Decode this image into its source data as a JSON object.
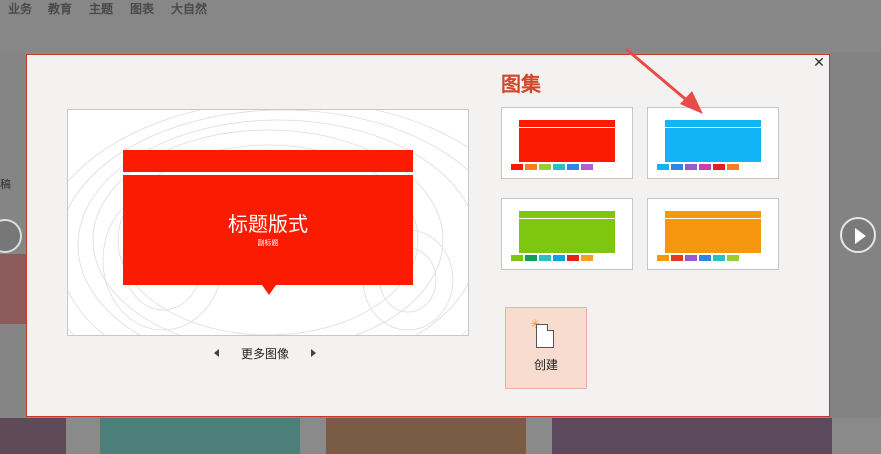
{
  "background": {
    "tabs": [
      "业务",
      "教育",
      "主题",
      "图表",
      "大自然"
    ],
    "left_partial_text": "稿"
  },
  "dialog": {
    "close_symbol": "✕",
    "preview": {
      "title": "标题版式",
      "subtitle": "副标题"
    },
    "more_images_label": "更多图像",
    "gallery_title": "图集",
    "variants": [
      {
        "main": "#fb1b00",
        "dots": [
          "#fb1b00",
          "#f77c22",
          "#9acd32",
          "#27c3c3",
          "#2e87e8",
          "#b75bd6"
        ]
      },
      {
        "main": "#12b4f5",
        "dots": [
          "#12b4f5",
          "#2e87e8",
          "#9b59d0",
          "#d23ca8",
          "#e52020",
          "#f77c22"
        ]
      },
      {
        "main": "#7ec60f",
        "dots": [
          "#7ec60f",
          "#129e55",
          "#27c3c3",
          "#12a0e0",
          "#e52020",
          "#f7a020"
        ]
      },
      {
        "main": "#f5980f",
        "dots": [
          "#f5980f",
          "#e53820",
          "#9b59d0",
          "#2e87e8",
          "#27c3c3",
          "#9acd32"
        ]
      }
    ],
    "create_label": "创建"
  },
  "colors": {
    "accent": "#d24726",
    "arrow": "#e84a4a"
  }
}
